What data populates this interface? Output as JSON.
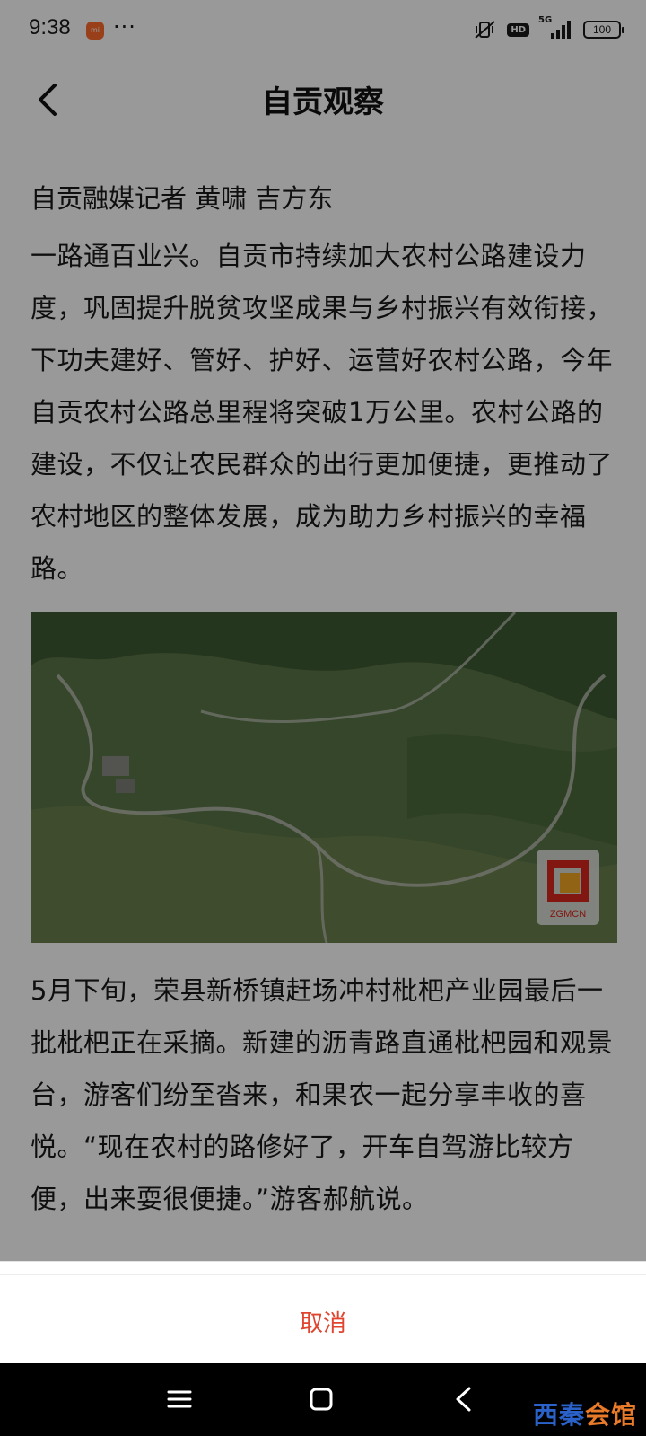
{
  "status": {
    "time": "9:38",
    "app_badge": "mi",
    "more": "···",
    "hd": "HD",
    "network": "5G",
    "battery": "100"
  },
  "header": {
    "title": "自贡观察"
  },
  "article": {
    "byline": "自贡融媒记者 黄啸 吉方东",
    "paragraph_1": "一路通百业兴。自贡市持续加大农村公路建设力度，巩固提升脱贫攻坚成果与乡村振兴有效衔接，下功夫建好、管好、护好、运营好农村公路，今年自贡农村公路总里程将突破1万公里。农村公路的建设，不仅让农民群众的出行更加便捷，更推动了农村地区的整体发展，成为助力乡村振兴的幸福路。",
    "photo_logo": "ZGMCN",
    "paragraph_2": "5月下旬，荣县新桥镇赶场冲村枇杷产业园最后一批枇杷正在采摘。新建的沥青路直通枇杷园和观景台，游客们纷至沓来，和果农一起分享丰收的喜悦。“现在农村的路修好了，开车自驾游比较方便，出来耍很便捷。”游客郝航说。"
  },
  "action_sheet": {
    "cancel_label": "取消"
  },
  "watermark": {
    "part_1": "西秦",
    "part_2": "会馆"
  },
  "colors": {
    "cancel": "#e0452f",
    "overlay": "rgba(0,0,0,0.40)",
    "nav_bar": "#000000"
  }
}
